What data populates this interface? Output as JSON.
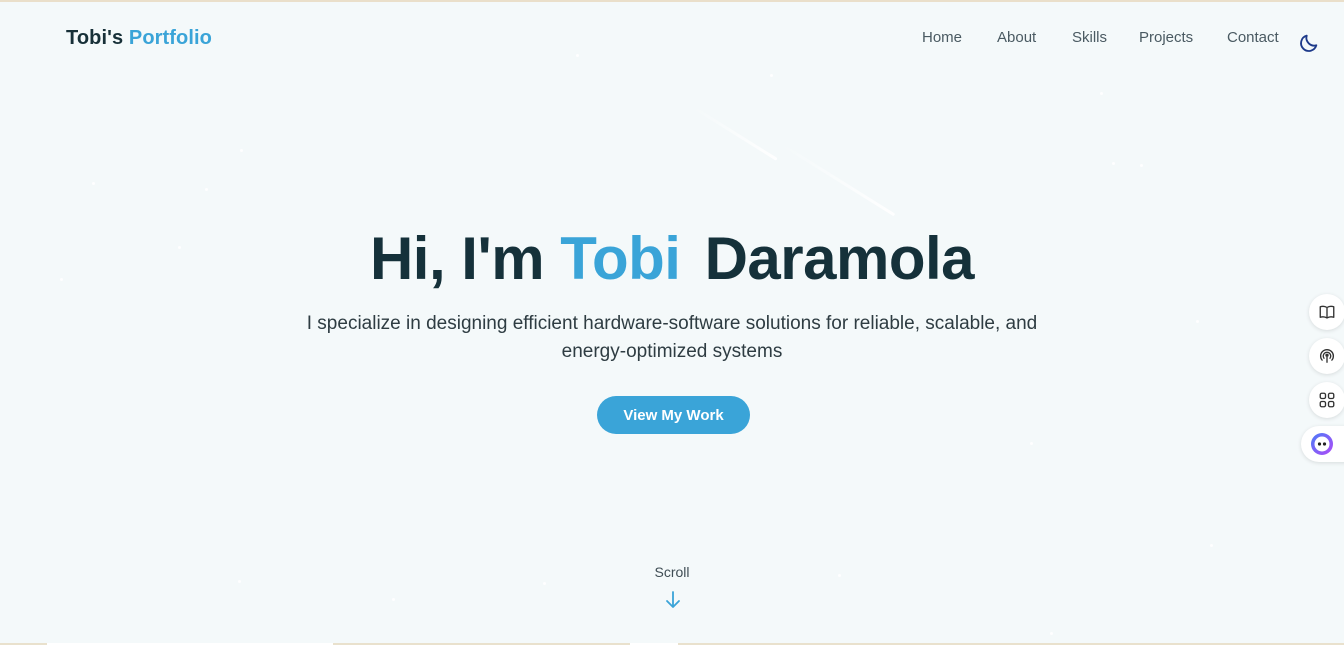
{
  "brand": {
    "first": "Tobi's",
    "second": "Portfolio"
  },
  "nav": {
    "items": [
      "Home",
      "About",
      "Skills",
      "Projects",
      "Contact"
    ]
  },
  "theme_toggle": {
    "icon": "moon-icon",
    "color": "#1d3a8a"
  },
  "hero": {
    "greeting": "Hi, I'm",
    "first_name": "Tobi",
    "last_name": "Daramola",
    "subtitle": "I specialize in designing efficient hardware-software solutions for reliable, scalable, and energy-optimized systems",
    "cta_label": "View My Work"
  },
  "scroll": {
    "label": "Scroll",
    "icon": "arrow-down-icon"
  },
  "side_toolbar": {
    "icons": [
      "book-icon",
      "broadcast-icon",
      "apps-grid-icon",
      "assistant-bot-icon"
    ]
  },
  "colors": {
    "accent": "#3aa4d8",
    "heading": "#15313a",
    "background": "#f4f9fa"
  }
}
